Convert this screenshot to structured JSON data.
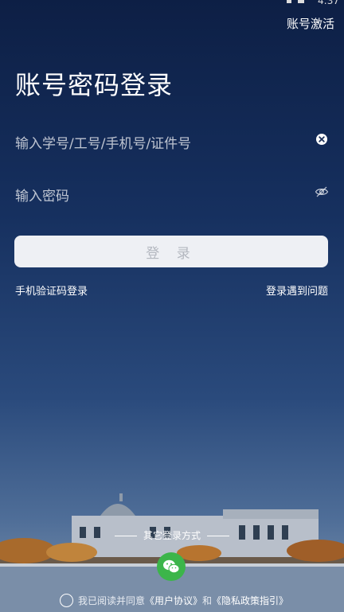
{
  "status_bar": {
    "time": "4:37"
  },
  "header": {
    "activate_label": "账号激活"
  },
  "page": {
    "title": "账号密码登录"
  },
  "form": {
    "account_placeholder": "输入学号/工号/手机号/证件号",
    "password_placeholder": "输入密码",
    "login_label": "登 录"
  },
  "links": {
    "sms_login": "手机验证码登录",
    "trouble": "登录遇到问题"
  },
  "other_login": {
    "label": "其它登录方式",
    "wechat_icon": "wechat-icon"
  },
  "agreement": {
    "prefix": "我已阅读并同意",
    "user_agreement": "《用户协议》",
    "and": "和",
    "privacy_policy": "《隐私政策指引》"
  },
  "colors": {
    "wechat_green": "#3cb54a",
    "button_bg": "#eef0f4"
  }
}
